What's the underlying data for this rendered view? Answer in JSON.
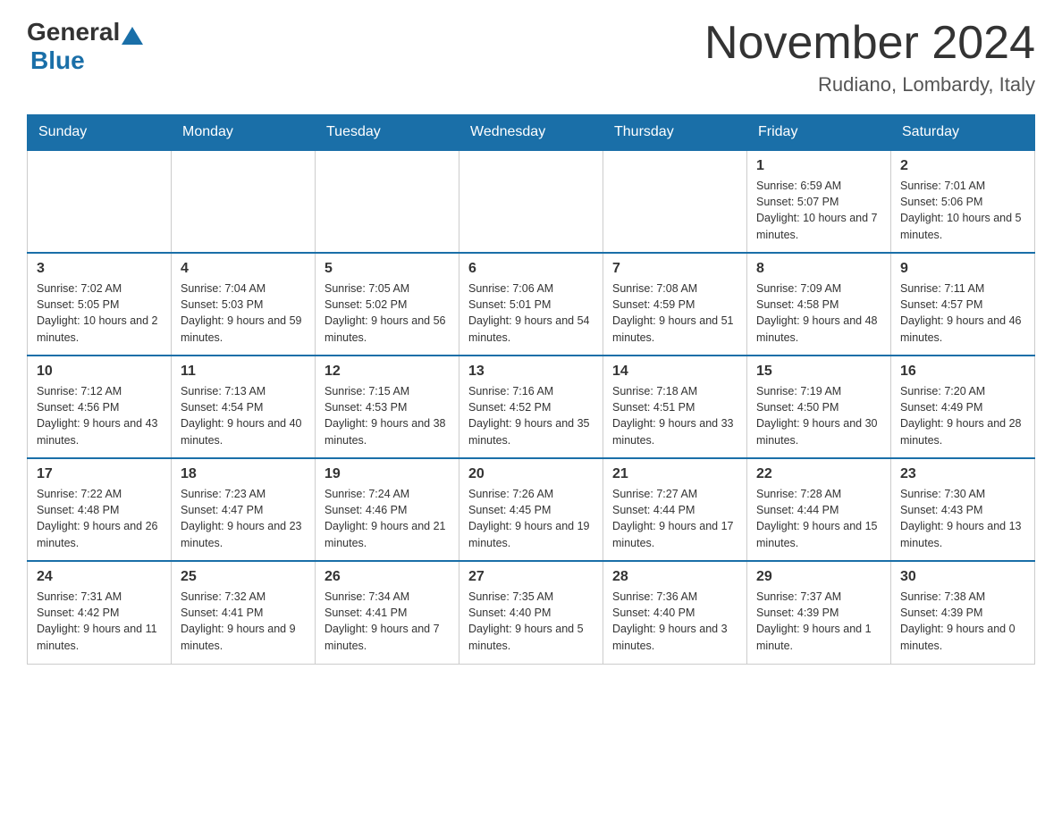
{
  "header": {
    "logo_general": "General",
    "logo_blue": "Blue",
    "month_title": "November 2024",
    "location": "Rudiano, Lombardy, Italy"
  },
  "days_of_week": [
    "Sunday",
    "Monday",
    "Tuesday",
    "Wednesday",
    "Thursday",
    "Friday",
    "Saturday"
  ],
  "weeks": [
    [
      {
        "day": "",
        "info": ""
      },
      {
        "day": "",
        "info": ""
      },
      {
        "day": "",
        "info": ""
      },
      {
        "day": "",
        "info": ""
      },
      {
        "day": "",
        "info": ""
      },
      {
        "day": "1",
        "info": "Sunrise: 6:59 AM\nSunset: 5:07 PM\nDaylight: 10 hours and 7 minutes."
      },
      {
        "day": "2",
        "info": "Sunrise: 7:01 AM\nSunset: 5:06 PM\nDaylight: 10 hours and 5 minutes."
      }
    ],
    [
      {
        "day": "3",
        "info": "Sunrise: 7:02 AM\nSunset: 5:05 PM\nDaylight: 10 hours and 2 minutes."
      },
      {
        "day": "4",
        "info": "Sunrise: 7:04 AM\nSunset: 5:03 PM\nDaylight: 9 hours and 59 minutes."
      },
      {
        "day": "5",
        "info": "Sunrise: 7:05 AM\nSunset: 5:02 PM\nDaylight: 9 hours and 56 minutes."
      },
      {
        "day": "6",
        "info": "Sunrise: 7:06 AM\nSunset: 5:01 PM\nDaylight: 9 hours and 54 minutes."
      },
      {
        "day": "7",
        "info": "Sunrise: 7:08 AM\nSunset: 4:59 PM\nDaylight: 9 hours and 51 minutes."
      },
      {
        "day": "8",
        "info": "Sunrise: 7:09 AM\nSunset: 4:58 PM\nDaylight: 9 hours and 48 minutes."
      },
      {
        "day": "9",
        "info": "Sunrise: 7:11 AM\nSunset: 4:57 PM\nDaylight: 9 hours and 46 minutes."
      }
    ],
    [
      {
        "day": "10",
        "info": "Sunrise: 7:12 AM\nSunset: 4:56 PM\nDaylight: 9 hours and 43 minutes."
      },
      {
        "day": "11",
        "info": "Sunrise: 7:13 AM\nSunset: 4:54 PM\nDaylight: 9 hours and 40 minutes."
      },
      {
        "day": "12",
        "info": "Sunrise: 7:15 AM\nSunset: 4:53 PM\nDaylight: 9 hours and 38 minutes."
      },
      {
        "day": "13",
        "info": "Sunrise: 7:16 AM\nSunset: 4:52 PM\nDaylight: 9 hours and 35 minutes."
      },
      {
        "day": "14",
        "info": "Sunrise: 7:18 AM\nSunset: 4:51 PM\nDaylight: 9 hours and 33 minutes."
      },
      {
        "day": "15",
        "info": "Sunrise: 7:19 AM\nSunset: 4:50 PM\nDaylight: 9 hours and 30 minutes."
      },
      {
        "day": "16",
        "info": "Sunrise: 7:20 AM\nSunset: 4:49 PM\nDaylight: 9 hours and 28 minutes."
      }
    ],
    [
      {
        "day": "17",
        "info": "Sunrise: 7:22 AM\nSunset: 4:48 PM\nDaylight: 9 hours and 26 minutes."
      },
      {
        "day": "18",
        "info": "Sunrise: 7:23 AM\nSunset: 4:47 PM\nDaylight: 9 hours and 23 minutes."
      },
      {
        "day": "19",
        "info": "Sunrise: 7:24 AM\nSunset: 4:46 PM\nDaylight: 9 hours and 21 minutes."
      },
      {
        "day": "20",
        "info": "Sunrise: 7:26 AM\nSunset: 4:45 PM\nDaylight: 9 hours and 19 minutes."
      },
      {
        "day": "21",
        "info": "Sunrise: 7:27 AM\nSunset: 4:44 PM\nDaylight: 9 hours and 17 minutes."
      },
      {
        "day": "22",
        "info": "Sunrise: 7:28 AM\nSunset: 4:44 PM\nDaylight: 9 hours and 15 minutes."
      },
      {
        "day": "23",
        "info": "Sunrise: 7:30 AM\nSunset: 4:43 PM\nDaylight: 9 hours and 13 minutes."
      }
    ],
    [
      {
        "day": "24",
        "info": "Sunrise: 7:31 AM\nSunset: 4:42 PM\nDaylight: 9 hours and 11 minutes."
      },
      {
        "day": "25",
        "info": "Sunrise: 7:32 AM\nSunset: 4:41 PM\nDaylight: 9 hours and 9 minutes."
      },
      {
        "day": "26",
        "info": "Sunrise: 7:34 AM\nSunset: 4:41 PM\nDaylight: 9 hours and 7 minutes."
      },
      {
        "day": "27",
        "info": "Sunrise: 7:35 AM\nSunset: 4:40 PM\nDaylight: 9 hours and 5 minutes."
      },
      {
        "day": "28",
        "info": "Sunrise: 7:36 AM\nSunset: 4:40 PM\nDaylight: 9 hours and 3 minutes."
      },
      {
        "day": "29",
        "info": "Sunrise: 7:37 AM\nSunset: 4:39 PM\nDaylight: 9 hours and 1 minute."
      },
      {
        "day": "30",
        "info": "Sunrise: 7:38 AM\nSunset: 4:39 PM\nDaylight: 9 hours and 0 minutes."
      }
    ]
  ]
}
